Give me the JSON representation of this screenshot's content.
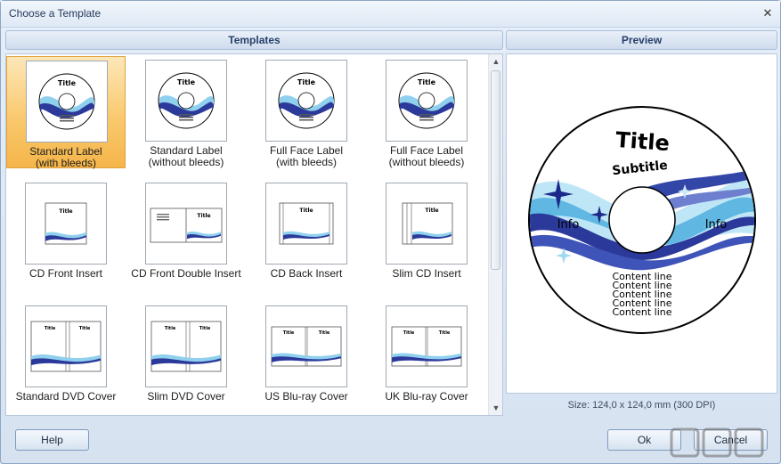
{
  "window": {
    "title": "Choose a Template",
    "close_glyph": "✕"
  },
  "templates_header": "Templates",
  "preview_header": "Preview",
  "templates": [
    {
      "label": "Standard Label\n(with bleeds)",
      "kind": "disc",
      "selected": true
    },
    {
      "label": "Standard Label\n(without bleeds)",
      "kind": "disc",
      "selected": false
    },
    {
      "label": "Full Face Label\n(with bleeds)",
      "kind": "disc",
      "selected": false
    },
    {
      "label": "Full Face Label\n(without bleeds)",
      "kind": "disc",
      "selected": false
    },
    {
      "label": "CD Front Insert",
      "kind": "front-insert",
      "selected": false
    },
    {
      "label": "CD Front Double Insert",
      "kind": "double-insert",
      "selected": false
    },
    {
      "label": "CD Back Insert",
      "kind": "back-insert",
      "selected": false
    },
    {
      "label": "Slim CD Insert",
      "kind": "slim-insert",
      "selected": false
    },
    {
      "label": "Standard DVD Cover",
      "kind": "dvd-cover",
      "selected": false
    },
    {
      "label": "Slim DVD Cover",
      "kind": "dvd-cover",
      "selected": false
    },
    {
      "label": "US Blu-ray Cover",
      "kind": "bluray-cover",
      "selected": false
    },
    {
      "label": "UK Blu-ray Cover",
      "kind": "bluray-cover",
      "selected": false
    }
  ],
  "preview": {
    "title": "Title",
    "subtitle": "Subtitle",
    "info_left": "Info",
    "info_right": "Info",
    "content_lines": [
      "Content line",
      "Content line",
      "Content line",
      "Content line",
      "Content line"
    ]
  },
  "size_text": "Size: 124,0 x 124,0 mm (300 DPI)",
  "buttons": {
    "help": "Help",
    "ok": "Ok",
    "cancel": "Cancel"
  },
  "icons": {
    "close": "close-icon",
    "scroll_up": "scroll-up-icon",
    "scroll_down": "scroll-down-icon"
  },
  "colors": {
    "selection": "#f9c96e",
    "wave_dark": "#2b3a9a",
    "wave_light": "#8fd0ee"
  }
}
